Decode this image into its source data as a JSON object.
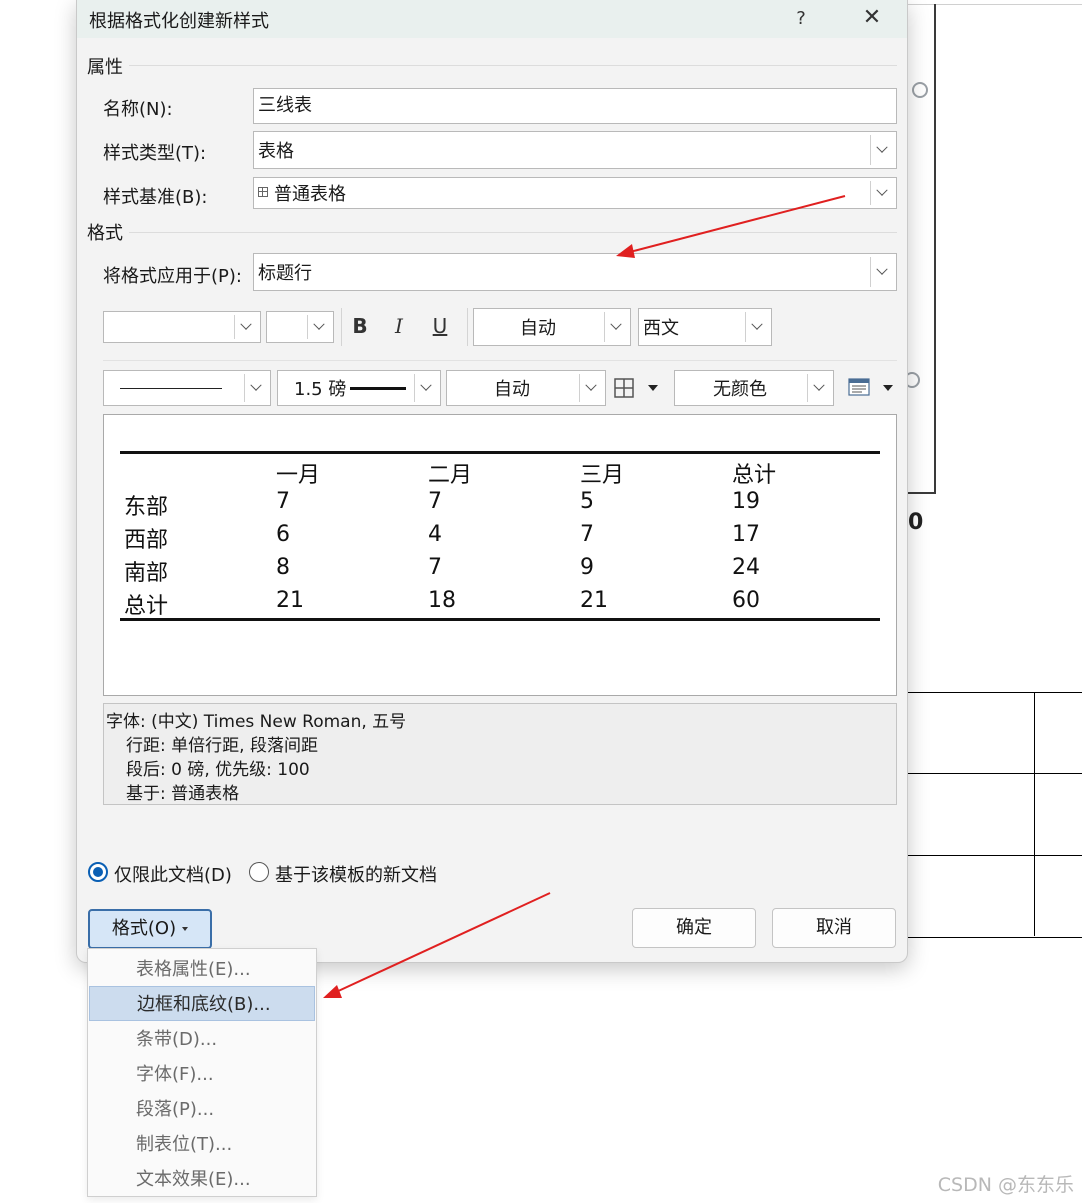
{
  "dialog": {
    "title": "根据格式化创建新样式",
    "help": "?",
    "close": "✕"
  },
  "properties": {
    "section_title": "属性",
    "name_label": "名称(N):",
    "name_value": "三线表",
    "type_label": "样式类型(T):",
    "type_value": "表格",
    "base_label": "样式基准(B):",
    "base_value": "普通表格"
  },
  "format": {
    "section_title": "格式",
    "apply_label": "将格式应用于(P):",
    "apply_value": "标题行",
    "font_name": "",
    "font_size": "",
    "bold": "B",
    "italic": "I",
    "underline": "U",
    "color": "自动",
    "script": "西文",
    "border_width": "1.5 磅",
    "border_color": "自动",
    "shading": "无颜色"
  },
  "preview": {
    "header": [
      "",
      "一月",
      "二月",
      "三月",
      "总计"
    ],
    "rows": [
      [
        "东部",
        "7",
        "7",
        "5",
        "19"
      ],
      [
        "西部",
        "6",
        "4",
        "7",
        "17"
      ],
      [
        "南部",
        "8",
        "7",
        "9",
        "24"
      ],
      [
        "总计",
        "21",
        "18",
        "21",
        "60"
      ]
    ]
  },
  "description": {
    "line1": "字体: (中文) Times New Roman, 五号",
    "line2": "行距: 单倍行距, 段落间距",
    "line3": "段后: 0 磅, 优先级: 100",
    "line4": "基于: 普通表格"
  },
  "options": {
    "this_doc": "仅限此文档(D)",
    "template_docs": "基于该模板的新文档"
  },
  "buttons": {
    "format": "格式(O)",
    "ok": "确定",
    "cancel": "取消"
  },
  "format_menu": {
    "items": [
      "表格属性(E)...",
      "边框和底纹(B)...",
      "条带(D)...",
      "字体(F)...",
      "段落(P)...",
      "制表位(T)...",
      "文本效果(E)..."
    ]
  },
  "background": {
    "digit": "0",
    "watermark": "CSDN @东东乐"
  },
  "colors": {
    "accent": "#0a5fb4",
    "arrow": "#e02020",
    "menu_highlight": "#ccdcee"
  }
}
